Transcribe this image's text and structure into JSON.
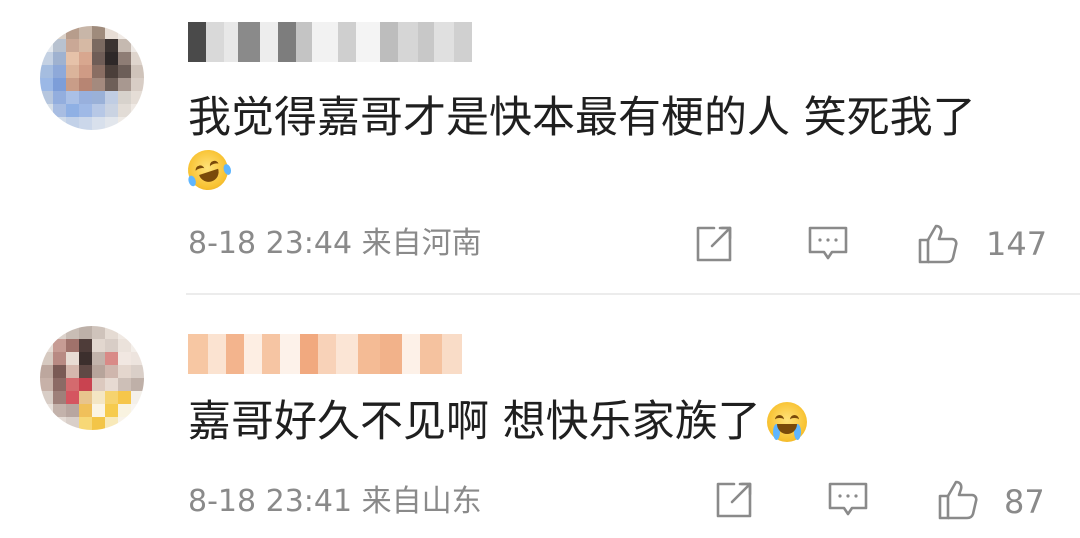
{
  "comments": [
    {
      "text": "我觉得嘉哥才是快本最有梗的人 笑死我了",
      "emoji": "laughing-crying-emoji",
      "time": "8-18 23:44",
      "location": "来自河南",
      "likes": "147"
    },
    {
      "text": "嘉哥好久不见啊 想快乐家族了",
      "emoji": "crying-emoji",
      "time": "8-18 23:41",
      "location": "来自山东",
      "likes": "87"
    }
  ],
  "icons": {
    "share": "share-icon",
    "reply": "reply-icon",
    "like": "thumbs-up-icon"
  },
  "colors": {
    "text": "#1f1f1f",
    "meta": "#8a8a8a",
    "divider": "#ececec"
  }
}
